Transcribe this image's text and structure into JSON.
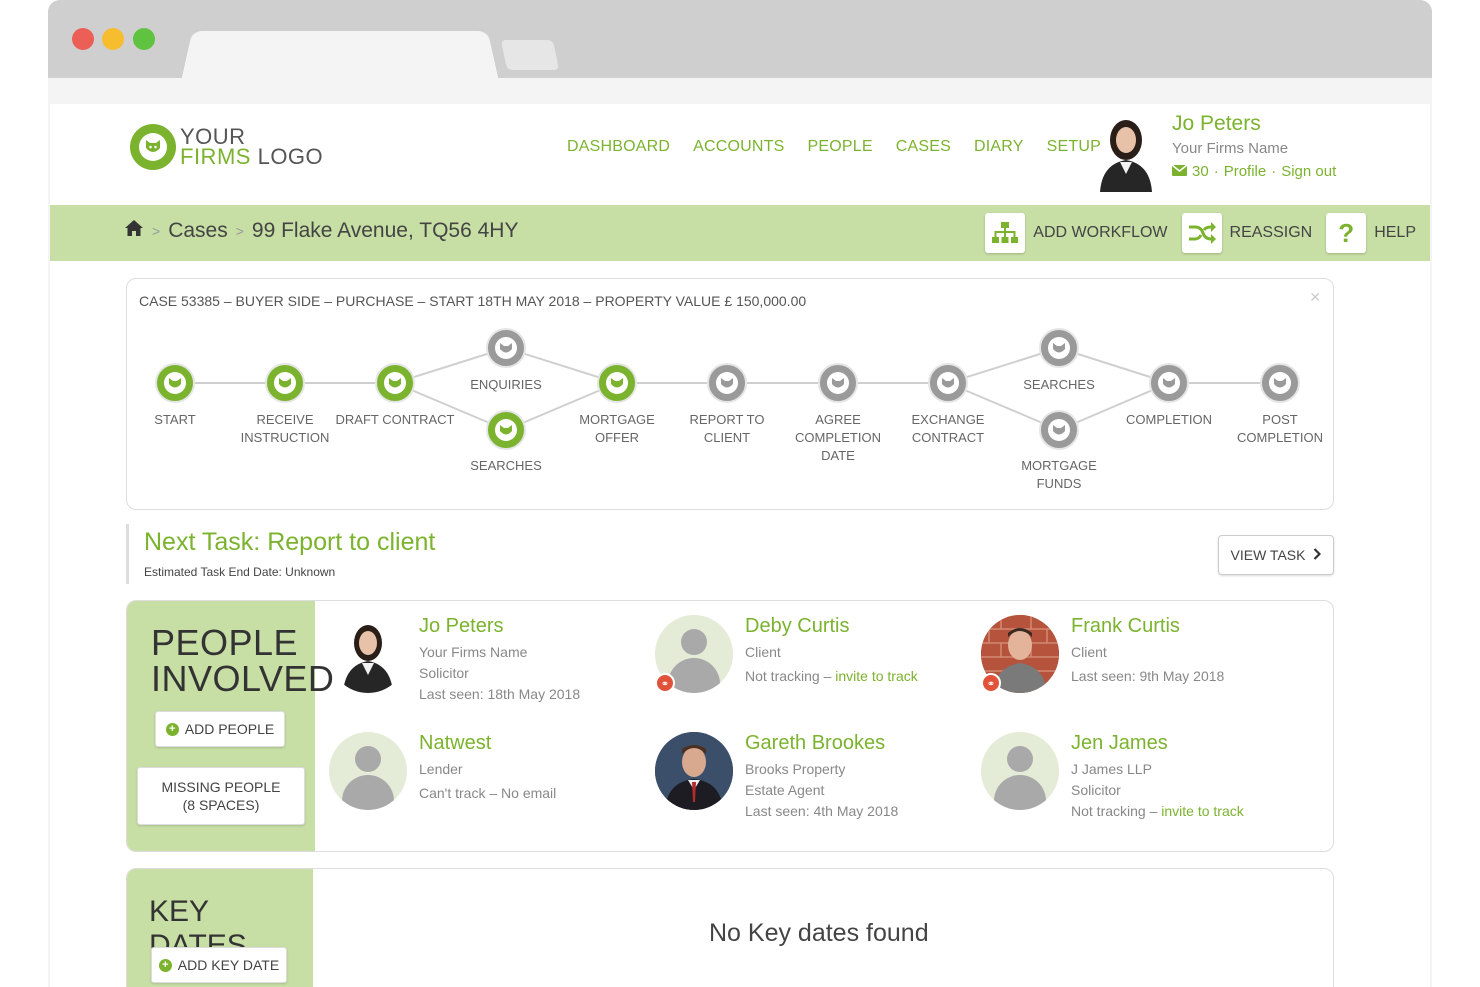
{
  "header": {
    "logo_line1": "YOUR",
    "logo_line2a": "FIRMS",
    "logo_line2b": "LOGO",
    "nav": [
      "DASHBOARD",
      "ACCOUNTS",
      "PEOPLE",
      "CASES",
      "DIARY",
      "SETUP"
    ],
    "user": {
      "name": "Jo Peters",
      "firm": "Your Firms Name",
      "messages": "30",
      "profile": "Profile",
      "signout": "Sign out"
    }
  },
  "breadcrumb": {
    "cases": "Cases",
    "property": "99 Flake Avenue, TQ56 4HY"
  },
  "actions": {
    "add_workflow": "ADD WORKFLOW",
    "reassign": "REASSIGN",
    "help": "HELP"
  },
  "workflow": {
    "case_title": "CASE 53385 – BUYER SIDE – PURCHASE – START 18TH MAY 2018 – PROPERTY VALUE £ 150,000.00",
    "nodes": [
      {
        "label": "START",
        "status": "done"
      },
      {
        "label": "RECEIVE INSTRUCTION",
        "status": "done"
      },
      {
        "label": "DRAFT CONTRACT",
        "status": "done"
      },
      {
        "label": "ENQUIRIES",
        "status": "pending"
      },
      {
        "label": "SEARCHES",
        "status": "done"
      },
      {
        "label": "MORTGAGE OFFER",
        "status": "done"
      },
      {
        "label": "REPORT TO CLIENT",
        "status": "pending"
      },
      {
        "label": "AGREE COMPLETION DATE",
        "status": "pending"
      },
      {
        "label": "EXCHANGE CONTRACT",
        "status": "pending"
      },
      {
        "label": "SEARCHES",
        "status": "pending"
      },
      {
        "label": "MORTGAGE FUNDS",
        "status": "pending"
      },
      {
        "label": "COMPLETION",
        "status": "pending"
      },
      {
        "label": "POST COMPLETION",
        "status": "pending"
      }
    ],
    "colors": {
      "done": "#7bb32e",
      "pending": "#9a9a9a"
    }
  },
  "next_task": {
    "prefix": "Next Task:",
    "task": "Report to client",
    "estimate": "Estimated Task End Date: Unknown",
    "view_button": "VIEW TASK"
  },
  "people": {
    "title_line1": "PEOPLE",
    "title_line2": "INVOLVED",
    "add_button": "ADD PEOPLE",
    "missing_line1": "MISSING PEOPLE",
    "missing_line2": "(8 SPACES)",
    "list": [
      {
        "name": "Jo Peters",
        "lines": [
          "Your Firms Name",
          "Solicitor",
          "Last seen: 18th May 2018"
        ]
      },
      {
        "name": "Deby Curtis",
        "lines": [
          "Client"
        ],
        "track_prefix": "Not tracking – ",
        "track_link": "invite to track"
      },
      {
        "name": "Frank Curtis",
        "lines": [
          "Client",
          "Last seen: 9th May 2018"
        ]
      },
      {
        "name": "Natwest",
        "lines": [
          "Lender",
          "Can't track – No email"
        ]
      },
      {
        "name": "Gareth Brookes",
        "lines": [
          "Brooks Property",
          "Estate Agent",
          "Last seen: 4th May 2018"
        ]
      },
      {
        "name": "Jen James",
        "lines": [
          "J James LLP",
          "Solicitor"
        ],
        "track_prefix": "Not tracking – ",
        "track_link": "invite to track"
      }
    ]
  },
  "key_dates": {
    "title": "KEY DATES",
    "add_button": "ADD KEY DATE",
    "empty": "No Key dates found"
  }
}
